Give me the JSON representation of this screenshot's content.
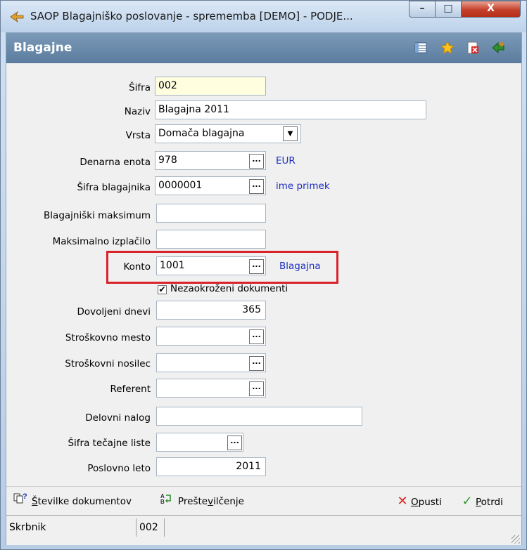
{
  "window": {
    "title": "SAOP Blagajniško poslovanje - sprememba [DEMO] - PODJE...",
    "min_glyph": "–",
    "max_glyph": "□",
    "close_glyph": "X"
  },
  "header": {
    "title": "Blagajne",
    "icons": [
      "table-icon",
      "star-icon",
      "delete-icon",
      "exit-icon"
    ]
  },
  "form": {
    "sifra": {
      "label": "Šifra",
      "value": "002"
    },
    "naziv": {
      "label": "Naziv",
      "value": "Blagajna 2011"
    },
    "vrsta": {
      "label": "Vrsta",
      "value": "Domača blagajna"
    },
    "denarna_enota": {
      "label": "Denarna enota",
      "value": "978",
      "desc": "EUR"
    },
    "sifra_blagajnika": {
      "label": "Šifra blagajnika",
      "value": "0000001",
      "desc": "ime primek"
    },
    "blagajniski_maksimum": {
      "label": "Blagajniški maksimum",
      "value": ""
    },
    "maksimalno_izplacilo": {
      "label": "Maksimalno izplačilo",
      "value": ""
    },
    "konto": {
      "label": "Konto",
      "value": "1001",
      "desc": "Blagajna"
    },
    "nezaokrozeni": {
      "label": "Nezaokroženi dokumenti",
      "checked": true,
      "mark": "✔"
    },
    "dovoljeni_dnevi": {
      "label": "Dovoljeni dnevi",
      "value": "365"
    },
    "stroskovno_mesto": {
      "label": "Stroškovno mesto",
      "value": ""
    },
    "stroskovni_nosilec": {
      "label": "Stroškovni  nosilec",
      "value": ""
    },
    "referent": {
      "label": "Referent",
      "value": ""
    },
    "delovni_nalog": {
      "label": "Delovni nalog",
      "value": ""
    },
    "sifra_tecajne_liste": {
      "label": "Šifra tečajne liste",
      "value": ""
    },
    "poslovno_leto": {
      "label": "Poslovno leto",
      "value": "2011"
    },
    "ellipsis": "..."
  },
  "buttons": {
    "stevilke_pre": "Š",
    "stevilke_rest": "tevilke dokumentov",
    "prestevilcenje_pre": "Prešte",
    "prestevilcenje_u": "v",
    "prestevilcenje_rest": "ilčenje",
    "opusti_u": "O",
    "opusti_rest": "pusti",
    "potrdi_u": "P",
    "potrdi_rest": "otrdi"
  },
  "status": {
    "label": "Skrbnik",
    "value": "002"
  },
  "colors": {
    "highlight": "#d8232a",
    "link": "#1c2fbf",
    "header": "#6b8bab"
  }
}
